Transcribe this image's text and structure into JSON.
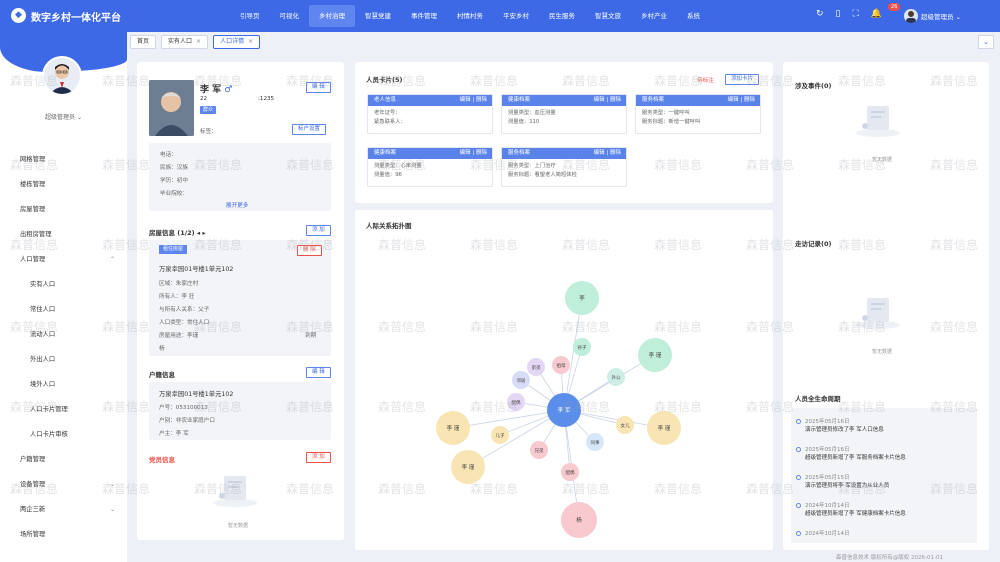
{
  "app": {
    "title": "数字乡村一体化平台",
    "logo": "shield-logo"
  },
  "nav": [
    "引导页",
    "可视化",
    "乡村治理",
    "智慧党建",
    "事件管理",
    "村情村务",
    "平安乡村",
    "民生服务",
    "智慧文旅",
    "乡村产业",
    "系统"
  ],
  "nav_active": "乡村治理",
  "header": {
    "badge_count": "26",
    "user": "超级管理员"
  },
  "sidebar": {
    "role": "超级管理员",
    "menu": [
      "网格管理",
      "楼栋管理",
      "房屋管理",
      "出租房管理",
      "人口管理",
      "实有人口",
      "常住人口",
      "流动人口",
      "外出人口",
      "境外人口",
      "人口卡片管理",
      "人口卡片审核",
      "户籍管理",
      "设备管理",
      "两企三新",
      "场所管理"
    ]
  },
  "tabs": [
    "首页",
    "实有人口",
    "人口详情"
  ],
  "person": {
    "name": "李 军",
    "gender_icon": "♂",
    "age": "22",
    "id_tail": ":1235",
    "tag": "群众",
    "edit": "编 辑",
    "label_tag": "标签：",
    "household_btn": "标户设置",
    "phone": "电话：",
    "nation": "民族：汉族",
    "edu": "学历：初中",
    "school": "毕业院校：",
    "expand": "展开更多"
  },
  "house": {
    "title": "房屋信息 (1/2)",
    "add": "添 加",
    "tag": "租住房屋",
    "delete": "删 除",
    "address": "万泉幸园01号楼1单元102",
    "rows": [
      "区域：朱家庄村",
      "所有人：李  狂",
      "与所有人关系：父子",
      "人口类型：常住人口",
      "房屋用途：李瑾",
      "杨"
    ],
    "extra": "到期"
  },
  "hukou": {
    "title": "户籍信息",
    "edit": "编 辑",
    "address": "万泉幸园01号楼1单元102",
    "rows": [
      "户号：053100013",
      "户别：非农业家庭户口",
      "户主：李  军"
    ]
  },
  "party": {
    "title": "党员信息",
    "add": "添 加",
    "empty": "暂无数据"
  },
  "cards": {
    "title": "人员卡片(5)",
    "tag": "待标注",
    "add": "添加卡片",
    "items": [
      {
        "head": "老人信息",
        "ops": "编辑 | 删除",
        "lines": [
          "老年证号：",
          "紧急联系人："
        ]
      },
      {
        "head": "健康档案",
        "ops": "编辑 | 删除",
        "lines": [
          "测量类型：血压测量",
          "测量值：110"
        ]
      },
      {
        "head": "服务档案",
        "ops": "编辑 | 删除",
        "lines": [
          "服务类型：一键呼叫",
          "服务标题：新增一键呼叫"
        ]
      },
      {
        "head": "健康档案",
        "ops": "编辑 | 删除",
        "lines": [
          "测量类型：心率测量",
          "测量值：96"
        ]
      },
      {
        "head": "服务档案",
        "ops": "编辑 | 删除",
        "lines": [
          "服务类型：上门治疗",
          "服务标题：看望老人简短体检"
        ]
      }
    ]
  },
  "graph": {
    "title": "人际关系拓扑图",
    "center": "李 军",
    "nodes": [
      "李",
      "李 瑾",
      "李 瑾",
      "李 瑾",
      "李 瑾",
      "杨",
      "孙子",
      "儿子",
      "女儿",
      "配偶",
      "兄弟",
      "祖母",
      "邻居",
      "弟弟",
      "配偶",
      "同事",
      "兄弟姐妹",
      "外公"
    ]
  },
  "events": {
    "title": "涉及事件(0)",
    "empty": "暂无数据"
  },
  "visits": {
    "title": "走访记录(0)",
    "empty": "暂无数据"
  },
  "lifecycle": {
    "title": "人员全生命周期",
    "items": [
      {
        "date": "2025年05月16日",
        "text": "演示管理员修改了李  军人口信息"
      },
      {
        "date": "2025年05月16日",
        "text": "超级管理员新增了李  军服务档案卡片信息"
      },
      {
        "date": "2025年05月15日",
        "text": "演示管理员将李  军设置为从业人员"
      },
      {
        "date": "2024年10月14日",
        "text": "超级管理员新增了李  军健康档案卡片信息"
      },
      {
        "date": "2024年10月14日",
        "text": ""
      }
    ]
  },
  "watermark": "森普信息",
  "footer": "森普信息技术  版权所有@版权  2026-01-01"
}
